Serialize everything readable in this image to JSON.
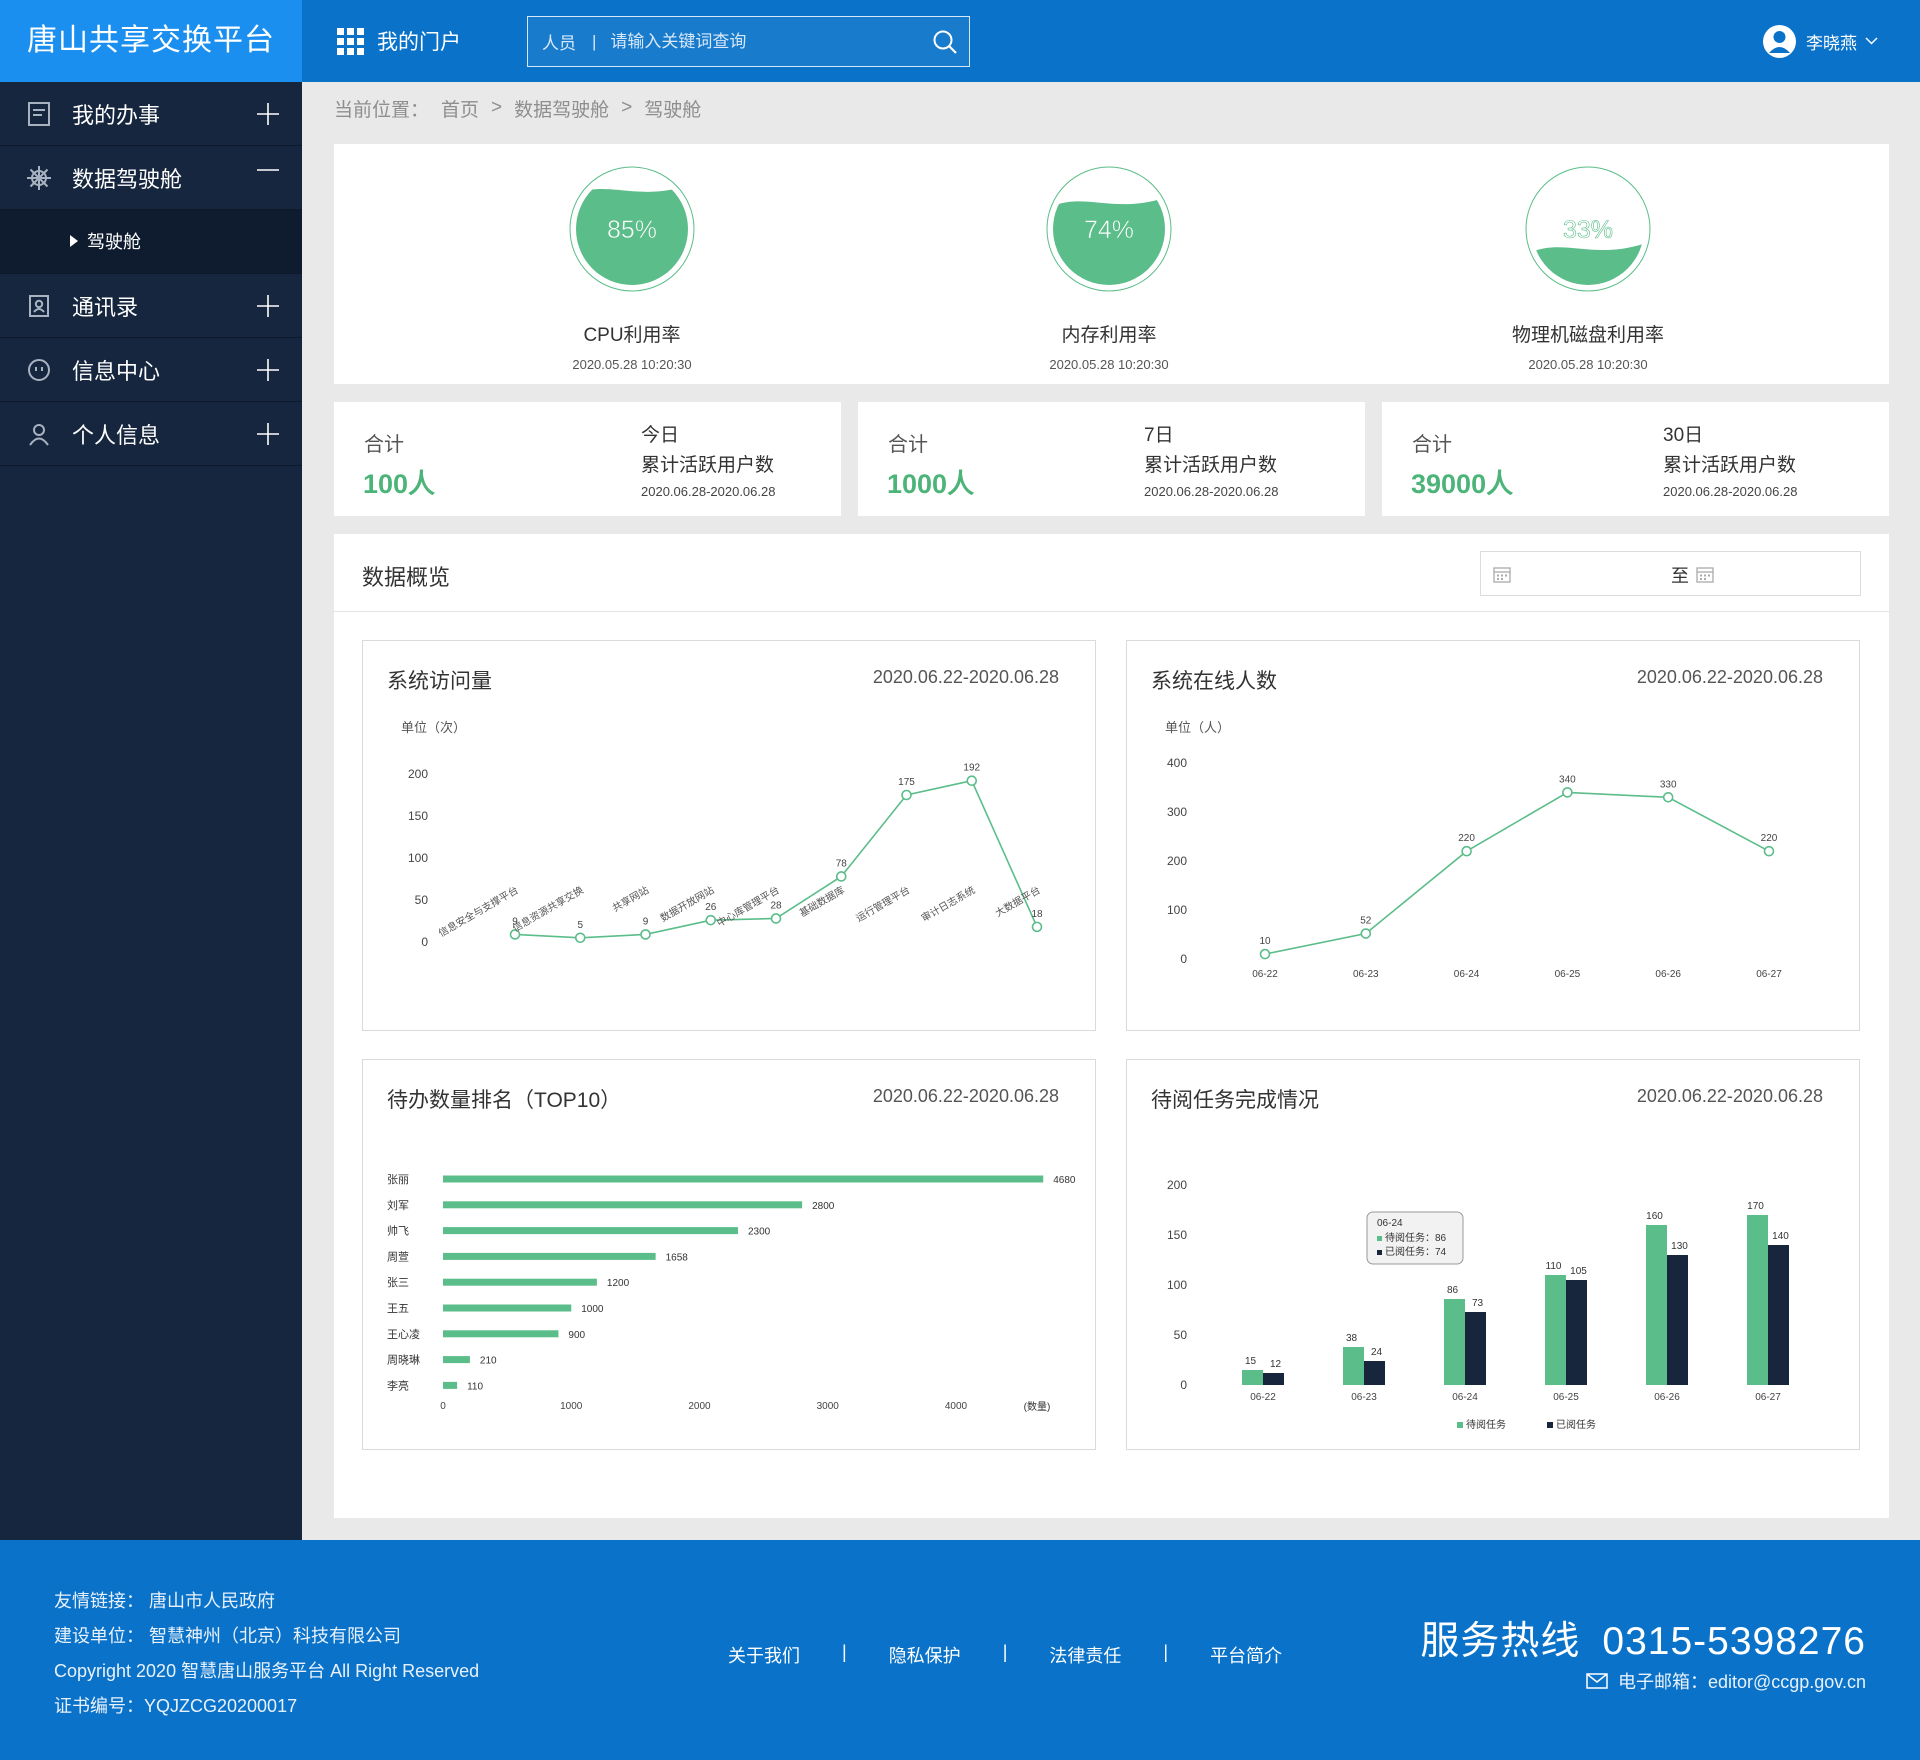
{
  "header": {
    "brand": "唐山共享交换平台",
    "portal_label": "我的门户",
    "search_category": "人员",
    "search_divider": "|",
    "search_placeholder": "请输入关键词查询",
    "user_name": "李晓燕"
  },
  "sidebar": {
    "items": [
      {
        "label": "我的办事",
        "icon": "document-icon",
        "state": "collapsed"
      },
      {
        "label": "数据驾驶舱",
        "icon": "helm-icon",
        "state": "expanded",
        "children": [
          {
            "label": "驾驶舱"
          }
        ]
      },
      {
        "label": "通讯录",
        "icon": "contacts-icon",
        "state": "collapsed"
      },
      {
        "label": "信息中心",
        "icon": "message-icon",
        "state": "collapsed"
      },
      {
        "label": "个人信息",
        "icon": "user-icon",
        "state": "collapsed"
      }
    ]
  },
  "breadcrumb": {
    "prefix": "当前位置：",
    "items": [
      "首页",
      ">",
      "数据驾驶舱",
      ">",
      "驾驶舱"
    ]
  },
  "gauges": [
    {
      "label": "85%",
      "value": 85,
      "title": "CPU利用率",
      "time": "2020.05.28 10:20:30"
    },
    {
      "label": "74%",
      "value": 74,
      "title": "内存利用率",
      "time": "2020.05.28 10:20:30"
    },
    {
      "label": "33%",
      "value": 33,
      "title": "物理机磁盘利用率",
      "time": "2020.05.28 10:20:30"
    }
  ],
  "stats": [
    {
      "label": "合计",
      "value": "100人",
      "period": "今日",
      "desc": "累计活跃用户数",
      "range": "2020.06.28-2020.06.28"
    },
    {
      "label": "合计",
      "value": "1000人",
      "period": "7日",
      "desc": "累计活跃用户数",
      "range": "2020.06.28-2020.06.28"
    },
    {
      "label": "合计",
      "value": "39000人",
      "period": "30日",
      "desc": "累计活跃用户数",
      "range": "2020.06.28-2020.06.28"
    }
  ],
  "overview": {
    "title": "数据概览",
    "date_to": "至"
  },
  "colors": {
    "primary": "#0a73c9",
    "brand_bg": "#1b8ff0",
    "sidebar": "#16263f",
    "green": "#5bbd89",
    "navy": "#17253d"
  },
  "panels": {
    "visits": {
      "title": "系统访问量",
      "range": "2020.06.22-2020.06.28",
      "unit": "单位（次）"
    },
    "online": {
      "title": "系统在线人数",
      "range": "2020.06.22-2020.06.28",
      "unit": "单位（人）"
    },
    "todo": {
      "title": "待办数量排名（TOP10）",
      "range": "2020.06.22-2020.06.28",
      "unit": "(数量)"
    },
    "reading": {
      "title": "待阅任务完成情况",
      "range": "2020.06.22-2020.06.28"
    }
  },
  "chart_data": [
    {
      "type": "line",
      "categories": [
        "信息安全与支撑平台",
        "信息资源共享交换",
        "共享网站",
        "数据开放网站",
        "中心库管理平台",
        "基础数据库",
        "运行管理平台",
        "审计日志系统",
        "大数据平台"
      ],
      "values": [
        9,
        5,
        9,
        26,
        28,
        78,
        175,
        192,
        18
      ],
      "yticks": [
        0,
        50,
        100,
        150,
        200
      ],
      "ylim": [
        0,
        200
      ],
      "ylabel": "单位（次）"
    },
    {
      "type": "line",
      "categories": [
        "06-22",
        "06-23",
        "06-24",
        "06-25",
        "06-26",
        "06-27"
      ],
      "values": [
        10,
        52,
        220,
        340,
        330,
        220
      ],
      "yticks": [
        0,
        100,
        200,
        300,
        400
      ],
      "ylim": [
        0,
        400
      ],
      "ylabel": "单位（人）"
    },
    {
      "type": "bar",
      "orientation": "horizontal",
      "categories": [
        "张丽",
        "刘军",
        "帅飞",
        "周萱",
        "张三",
        "王五",
        "王心凌",
        "周晓琳",
        "李亮"
      ],
      "values": [
        4680,
        2800,
        2300,
        1658,
        1200,
        1000,
        900,
        210,
        110
      ],
      "xticks": [
        0,
        1000,
        2000,
        3000,
        4000
      ],
      "xlabel": "(数量)"
    },
    {
      "type": "bar",
      "categories": [
        "06-22",
        "06-23",
        "06-24",
        "06-25",
        "06-26",
        "06-27"
      ],
      "yticks": [
        0,
        50,
        100,
        150,
        200
      ],
      "ylim": [
        0,
        200
      ],
      "series": [
        {
          "name": "待阅任务",
          "values": [
            15,
            38,
            86,
            110,
            160,
            170
          ],
          "color": "#5bbd89"
        },
        {
          "name": "已阅任务",
          "values": [
            12,
            24,
            73,
            105,
            130,
            140
          ],
          "color": "#17253d"
        }
      ],
      "tooltip": {
        "category": "06-24",
        "lines": [
          "待阅任务：86",
          "已阅任务：74"
        ]
      }
    }
  ],
  "footer": {
    "friend_links": "友情链接：  唐山市人民政府",
    "builder": "建设单位：  智慧神州（北京）科技有限公司",
    "copyright": "Copyright 2020 智慧唐山服务平台 All Right Reserved",
    "cert": "证书编号：YQJZCG20200017",
    "links": [
      "关于我们",
      "隐私保护",
      "法律责任",
      "平台简介"
    ],
    "link_separator": "|",
    "hotline_label": "服务热线",
    "hotline_number": "0315-5398276",
    "email": "电子邮箱：editor@ccgp.gov.cn"
  }
}
